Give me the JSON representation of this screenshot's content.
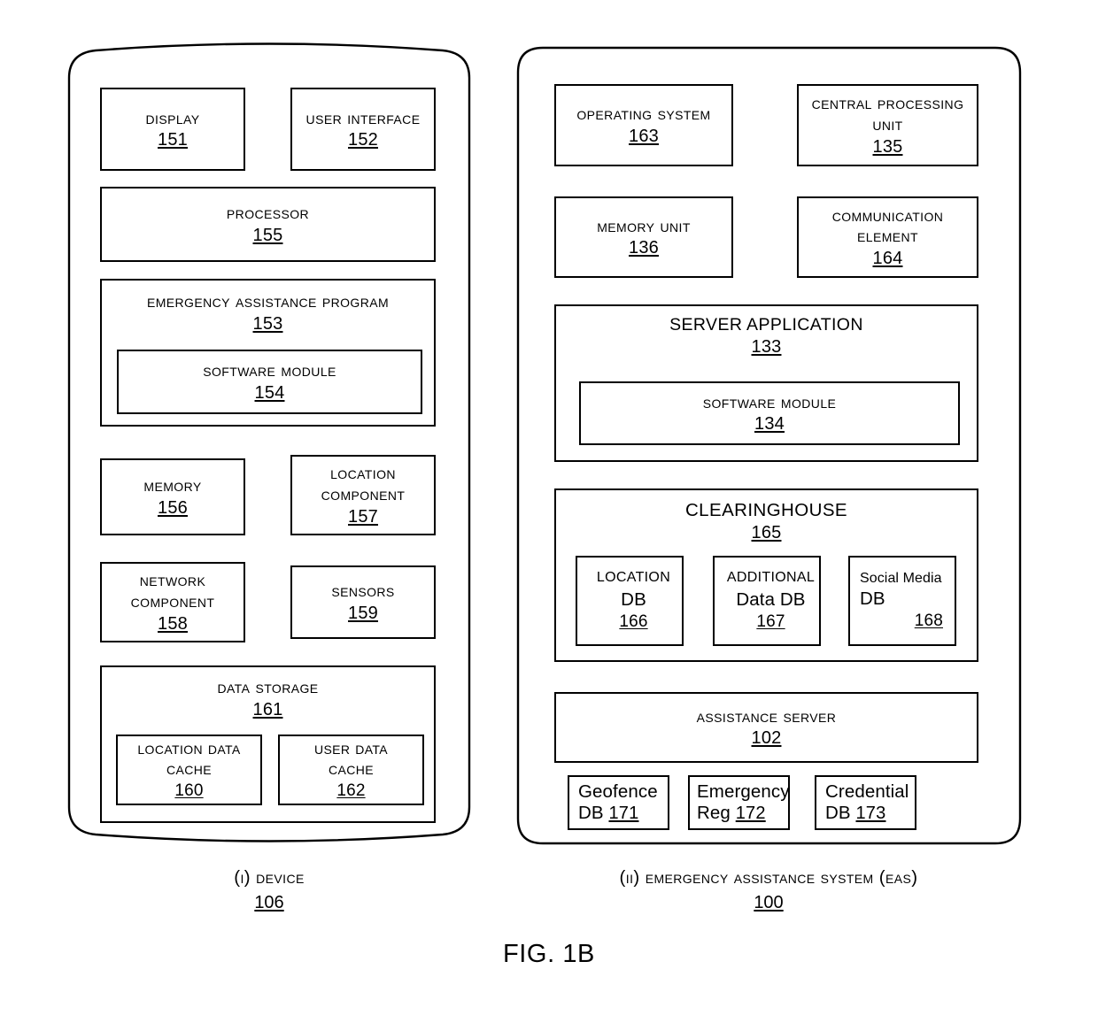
{
  "figure": {
    "label": "FIG. 1B"
  },
  "device_panel": {
    "caption_text": "(I) Device",
    "caption_number": "106",
    "boxes": {
      "display": {
        "title": "Display",
        "number": "151"
      },
      "user_interface": {
        "title": "User Interface",
        "number": "152"
      },
      "processor": {
        "title": "Processor",
        "number": "155"
      },
      "emergency_assistance_program": {
        "title": "Emergency Assistance Program",
        "number": "153"
      },
      "software_module": {
        "title": "Software Module",
        "number": "154"
      },
      "memory": {
        "title": "Memory",
        "number": "156"
      },
      "location_component": {
        "title": "Location\nComponent",
        "number": "157"
      },
      "network_component": {
        "title": "Network\nComponent",
        "number": "158"
      },
      "sensors": {
        "title": "Sensors",
        "number": "159"
      },
      "data_storage": {
        "title": "Data Storage",
        "number": "161"
      },
      "location_data_cache": {
        "title": "Location Data\nCache",
        "number": "160"
      },
      "user_data_cache": {
        "title": "User Data\nCache",
        "number": "162"
      }
    }
  },
  "eas_panel": {
    "caption_text": "(II) Emergency Assistance System (EAS)",
    "caption_number": "100",
    "boxes": {
      "operating_system": {
        "title": "Operating System",
        "number": "163"
      },
      "central_processing_unit": {
        "title": "Central Processing\nUnit",
        "number": "135"
      },
      "memory_unit": {
        "title": "Memory Unit",
        "number": "136"
      },
      "communication_element": {
        "title": "Communication\nElement",
        "number": "164"
      },
      "server_application": {
        "title": "SERVER APPLICATION",
        "number": "133"
      },
      "software_module": {
        "title": "Software Module",
        "number": "134"
      },
      "clearinghouse": {
        "title": "CLEARINGHOUSE",
        "number": "165"
      },
      "location_db": {
        "title_small": "LOCATION",
        "title_large": "DB",
        "number": "166"
      },
      "additional_data_db": {
        "title_small": "ADDITIONAL",
        "title_large": "Data DB",
        "number": "167"
      },
      "social_media_db": {
        "title_small": "Social Media",
        "title_large": "DB",
        "number": "168"
      },
      "assistance_server": {
        "title": "Assistance Server",
        "number": "102"
      },
      "geofence_db": {
        "line1": "Geofence",
        "line2_prefix": "DB ",
        "number": "171"
      },
      "emergency_reg": {
        "line1": "Emergency",
        "line2_prefix": "Reg ",
        "number": "172"
      },
      "credential_db": {
        "line1": "Credential",
        "line2_prefix": "DB ",
        "number": "173"
      }
    }
  },
  "colors": {
    "stroke": "#000000",
    "background": "#ffffff"
  }
}
